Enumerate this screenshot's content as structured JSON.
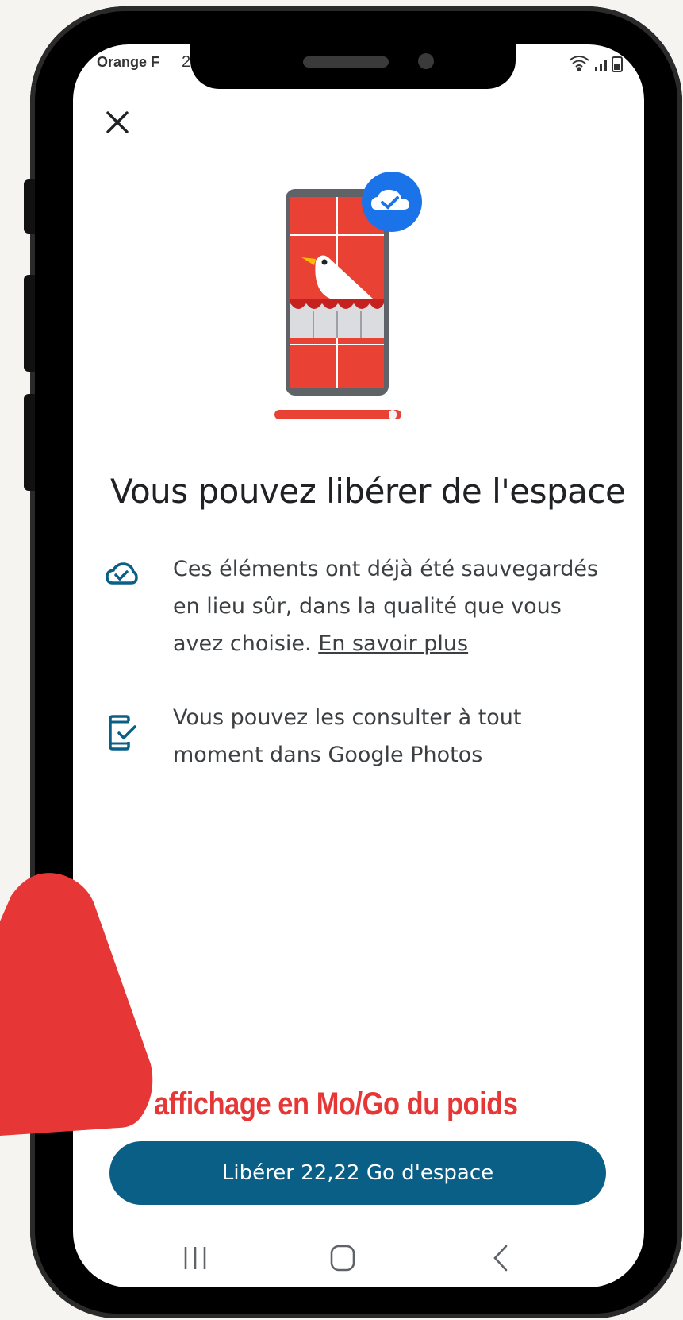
{
  "status_bar": {
    "carrier": "Orange F",
    "time": "2"
  },
  "icons": {
    "close": "close-icon",
    "cloud_check": "cloud-check-icon",
    "phone_check": "phone-check-icon",
    "nav_recents": "recents-icon",
    "nav_home": "home-icon",
    "nav_back": "back-icon"
  },
  "dialog": {
    "title": "Vous pouvez libérer de l'espace",
    "items": [
      {
        "text": "Ces éléments ont déjà été sauvegardés en lieu sûr, dans la qualité que vous avez choisie.",
        "link": "En savoir plus"
      },
      {
        "text": "Vous pouvez les consulter à tout moment dans Google Photos"
      }
    ],
    "primary_button": "Libérer 22,22 Go d'espace"
  },
  "annotation": {
    "text": "affichage en Mo/Go du poids"
  },
  "colors": {
    "accent": "#0a5f87",
    "annotation_red": "#e63636",
    "badge_blue": "#1a73e8",
    "illustration_red": "#e94234"
  }
}
